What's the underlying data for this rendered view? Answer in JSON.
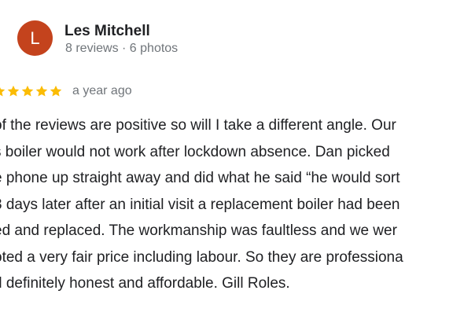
{
  "reviewer": {
    "avatar_initial": "L",
    "avatar_color": "#c4431d",
    "name": "Les Mitchell",
    "meta": "8 reviews · 6 photos"
  },
  "review": {
    "rating": 5,
    "star_color": "#fbbc04",
    "time": "a year ago",
    "lines": [
      "of the reviews are positive so will I take a different angle. Our",
      "s boiler would not work after lockdown absence. Dan picked",
      "e phone up straight away and did what he said “he would sort",
      "3 days later after an initial visit a replacement boiler had been",
      "ed and replaced. The workmanship was faultless and we wer",
      "oted a very fair price including labour. So they are professiona",
      "d definitely honest and affordable. Gill Roles."
    ]
  }
}
